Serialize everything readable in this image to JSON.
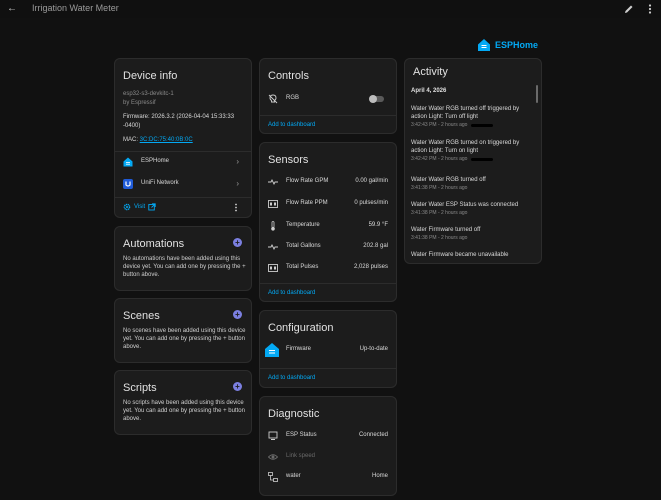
{
  "header": {
    "title": "Irrigation Water Meter"
  },
  "brand": {
    "name": "ESPHome"
  },
  "device_info": {
    "title": "Device info",
    "model": "esp32-s3-devkitc-1",
    "manufacturer": "by Espressif",
    "firmware": "Firmware: 2026.3.2 (2026-04-04 15:33:33 -0400)",
    "mac_label": "MAC: ",
    "mac": "3C:DC:75:40:0B:0C",
    "integrations": [
      {
        "name": "ESPHome",
        "icon": "esphome-icon"
      },
      {
        "name": "UniFi Network",
        "icon": "unifi-icon"
      }
    ],
    "visit_label": "Visit"
  },
  "automations": {
    "title": "Automations",
    "text": "No automations have been added using this device yet. You can add one by pressing the + button above."
  },
  "scenes": {
    "title": "Scenes",
    "text": "No scenes have been added using this device yet. You can add one by pressing the + button above."
  },
  "scripts": {
    "title": "Scripts",
    "text": "No scripts have been added using this device yet. You can add one by pressing the + button above."
  },
  "controls": {
    "title": "Controls",
    "items": [
      {
        "label": "RGB",
        "state": "off"
      }
    ],
    "add_link": "Add to dashboard"
  },
  "sensors": {
    "title": "Sensors",
    "items": [
      {
        "label": "Flow Rate GPM",
        "value": "0.00 gal/min",
        "icon": "pulse-icon"
      },
      {
        "label": "Flow Rate PPM",
        "value": "0 pulses/min",
        "icon": "counter-icon"
      },
      {
        "label": "Temperature",
        "value": "59.9 °F",
        "icon": "thermometer-icon"
      },
      {
        "label": "Total Gallons",
        "value": "202.8 gal",
        "icon": "pulse-icon"
      },
      {
        "label": "Total Pulses",
        "value": "2,028 pulses",
        "icon": "counter-icon"
      }
    ],
    "add_link": "Add to dashboard"
  },
  "configuration": {
    "title": "Configuration",
    "items": [
      {
        "label": "Firmware",
        "value": "Up-to-date"
      }
    ],
    "add_link": "Add to dashboard"
  },
  "diagnostic": {
    "title": "Diagnostic",
    "items": [
      {
        "label": "ESP Status",
        "value": "Connected",
        "icon": "chip-icon"
      },
      {
        "label": "Link speed",
        "value": "",
        "icon": "eye-icon"
      },
      {
        "label": "water",
        "value": "Home",
        "icon": "network-icon"
      }
    ]
  },
  "activity": {
    "title": "Activity",
    "date": "April 4, 2026",
    "items": [
      {
        "text": "Water Water RGB turned off triggered by action Light: Turn off light",
        "time": "3:42:43 PM - 2 hours ago"
      },
      {
        "text": "Water Water RGB turned on triggered by action Light: Turn on light",
        "time": "3:42:42 PM - 2 hours ago"
      },
      {
        "text": "Water Water RGB turned off",
        "time": "3:41:38 PM - 2 hours ago"
      },
      {
        "text": "Water Water ESP Status was connected",
        "time": "3:41:38 PM - 2 hours ago"
      },
      {
        "text": "Water Firmware turned off",
        "time": "3:41:38 PM - 2 hours ago"
      },
      {
        "text": "Water Firmware became unavailable",
        "time": ""
      }
    ]
  },
  "colors": {
    "accent": "#03a9f4",
    "fab": "#7b7fe0",
    "card": "#1c1c1c",
    "background": "#111111"
  }
}
